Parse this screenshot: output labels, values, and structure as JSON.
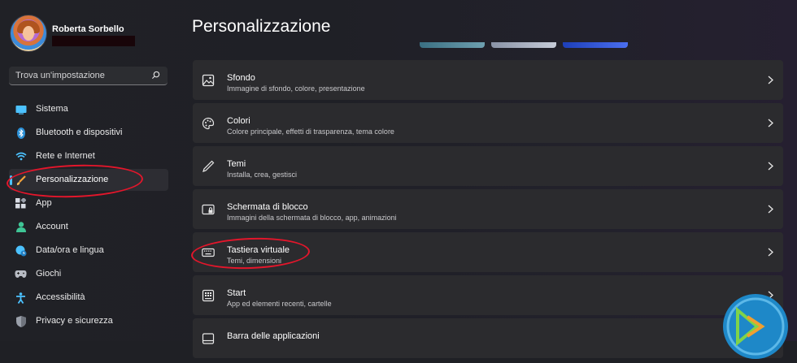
{
  "user": {
    "name": "Roberta Sorbello"
  },
  "search": {
    "placeholder": "Trova un'impostazione"
  },
  "sidebar": {
    "items": [
      {
        "label": "Sistema",
        "icon": "monitor-icon",
        "color": "#4cc2ff"
      },
      {
        "label": "Bluetooth e dispositivi",
        "icon": "bluetooth-icon",
        "color": "#4cc2ff"
      },
      {
        "label": "Rete e Internet",
        "icon": "wifi-icon",
        "color": "#4cc2ff"
      },
      {
        "label": "Personalizzazione",
        "icon": "brush-icon",
        "color": "#f4a23a",
        "active": true
      },
      {
        "label": "App",
        "icon": "apps-icon",
        "color": "#d8dce4"
      },
      {
        "label": "Account",
        "icon": "person-icon",
        "color": "#3fc596"
      },
      {
        "label": "Data/ora e lingua",
        "icon": "globe-clock-icon",
        "color": "#4cc2ff"
      },
      {
        "label": "Giochi",
        "icon": "gamepad-icon",
        "color": "#b8bcc4"
      },
      {
        "label": "Accessibilità",
        "icon": "accessibility-icon",
        "color": "#4cc2ff"
      },
      {
        "label": "Privacy e sicurezza",
        "icon": "shield-icon",
        "color": "#9aa0aa"
      }
    ]
  },
  "main": {
    "title": "Personalizzazione",
    "cards": [
      {
        "title": "Sfondo",
        "desc": "Immagine di sfondo, colore, presentazione",
        "icon": "image-icon"
      },
      {
        "title": "Colori",
        "desc": "Colore principale, effetti di trasparenza, tema colore",
        "icon": "palette-icon"
      },
      {
        "title": "Temi",
        "desc": "Installa, crea, gestisci",
        "icon": "pen-icon"
      },
      {
        "title": "Schermata di blocco",
        "desc": "Immagini della schermata di blocco, app, animazioni",
        "icon": "lock-screen-icon"
      },
      {
        "title": "Tastiera virtuale",
        "desc": "Temi, dimensioni",
        "icon": "keyboard-icon"
      },
      {
        "title": "Start",
        "desc": "App ed elementi recenti, cartelle",
        "icon": "start-icon"
      },
      {
        "title": "Barra delle applicazioni",
        "desc": "",
        "icon": "taskbar-icon"
      }
    ]
  },
  "colors": {
    "accent": "#4cc2ff",
    "annotation": "#e3162b",
    "card": "#2b2b2e"
  }
}
